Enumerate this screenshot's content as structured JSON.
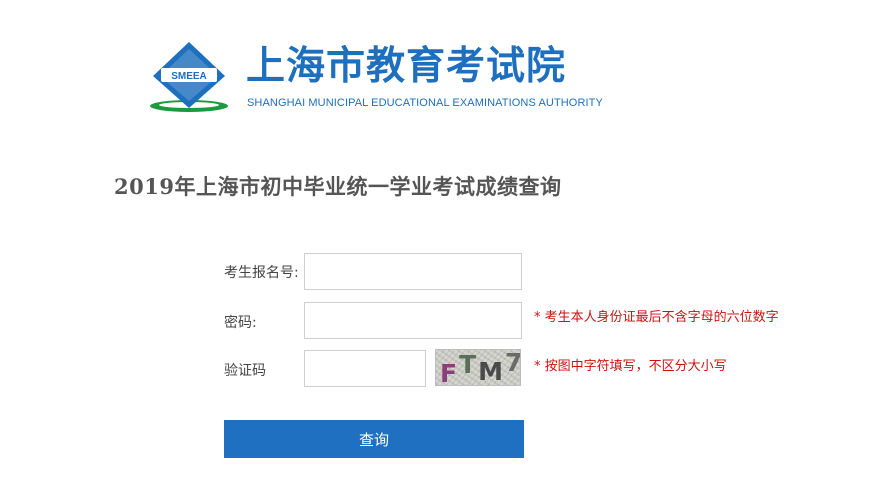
{
  "header": {
    "logo_text": "SMEEA",
    "org_name_cn": "上海市教育考试院",
    "org_name_en": "SHANGHAI MUNICIPAL EDUCATIONAL EXAMINATIONS AUTHORITY"
  },
  "page_title": "2019年上海市初中毕业统一学业考试成绩查询",
  "form": {
    "exam_number": {
      "label": "考生报名号:",
      "value": "",
      "placeholder": ""
    },
    "password": {
      "label": "密码:",
      "value": "",
      "placeholder": "",
      "hint": "* 考生本人身份证最后不含字母的六位数字"
    },
    "captcha": {
      "label": "验证码",
      "value": "",
      "placeholder": "",
      "image_text": "FTM7",
      "hint": "* 按图中字符填写，不区分大小写"
    },
    "submit_label": "查询"
  },
  "colors": {
    "brand_blue": "#1e6fbd",
    "logo_green": "#1e9a3e",
    "hint_red": "#cc1111",
    "button_blue": "#1f70c1"
  }
}
